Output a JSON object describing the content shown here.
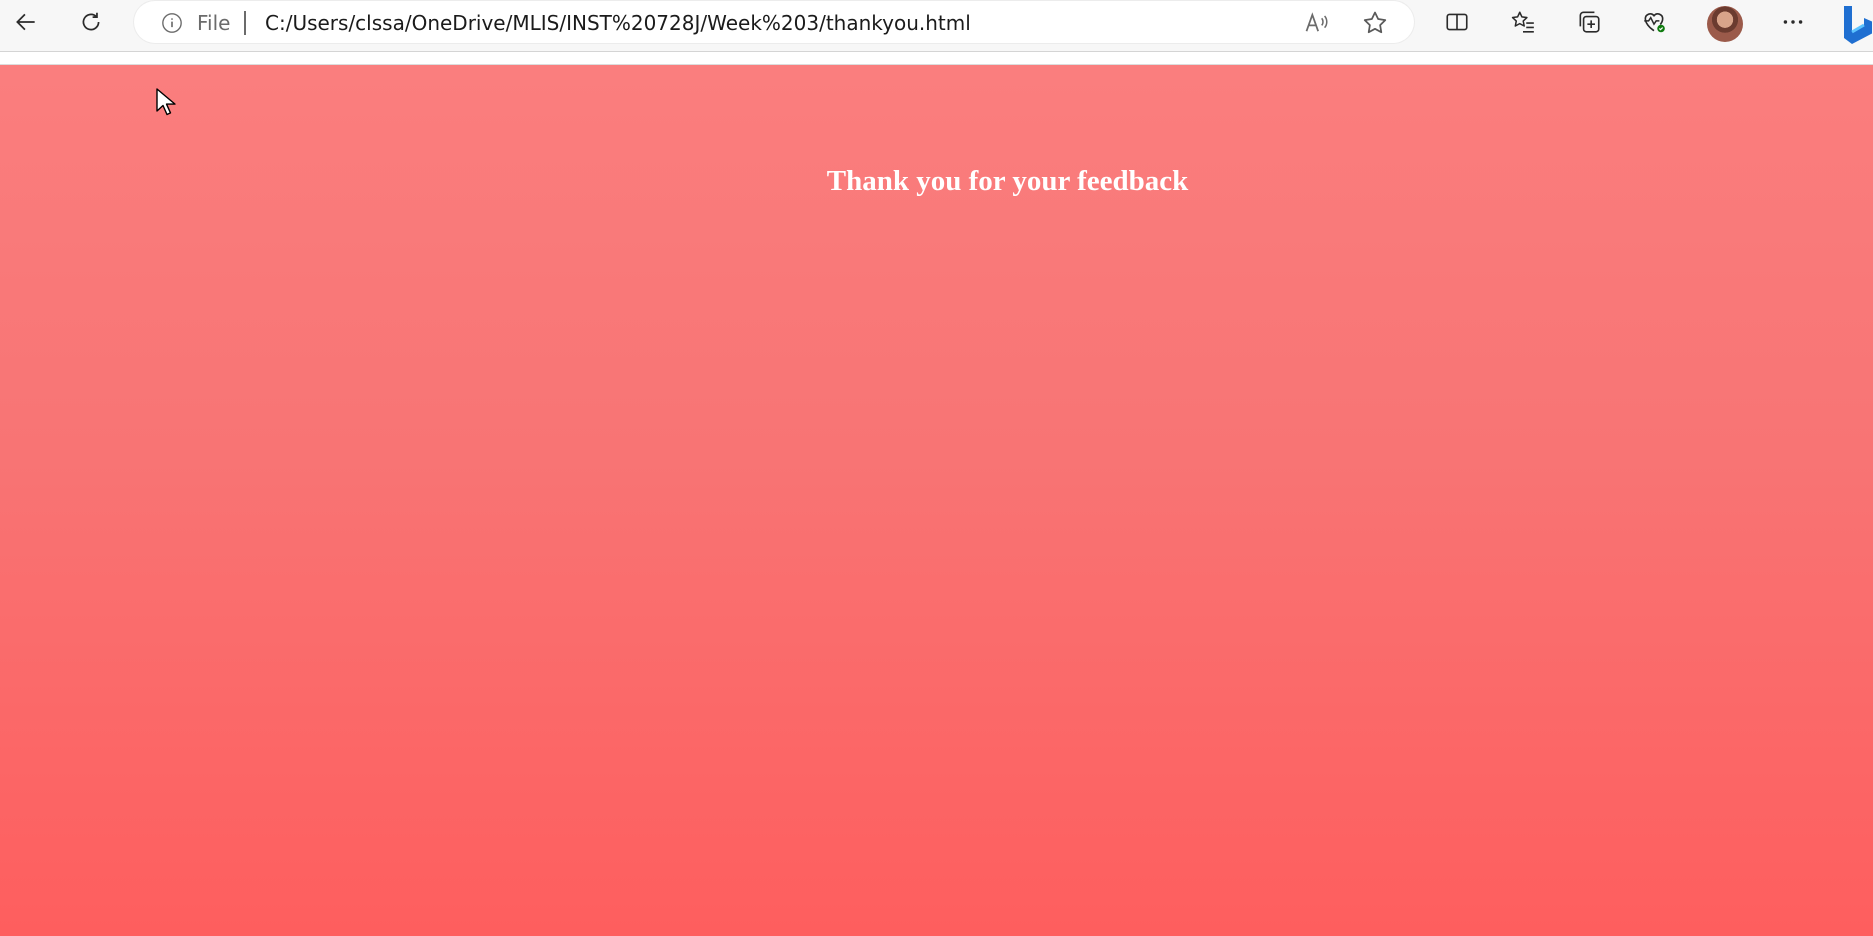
{
  "browser": {
    "address": {
      "scheme_label": "File",
      "url": "C:/Users/clssa/OneDrive/MLIS/INST%20728J/Week%203/thankyou.html"
    },
    "icons": {
      "back": "back-arrow-icon",
      "refresh": "refresh-icon",
      "info": "info-icon",
      "read_aloud": "read-aloud-icon",
      "favorite": "favorite-star-icon",
      "split_screen": "split-screen-icon",
      "favorites": "favorites-list-icon",
      "collections": "collections-icon",
      "browser_essentials": "heartbeat-icon",
      "profile": "profile-avatar",
      "more": "more-menu-icon",
      "copilot": "copilot-icon"
    }
  },
  "page": {
    "heading": "Thank you for your feedback",
    "background_top": "#fa7e7e",
    "background_bottom": "#fe5e5e",
    "heading_color": "#ffffff"
  }
}
